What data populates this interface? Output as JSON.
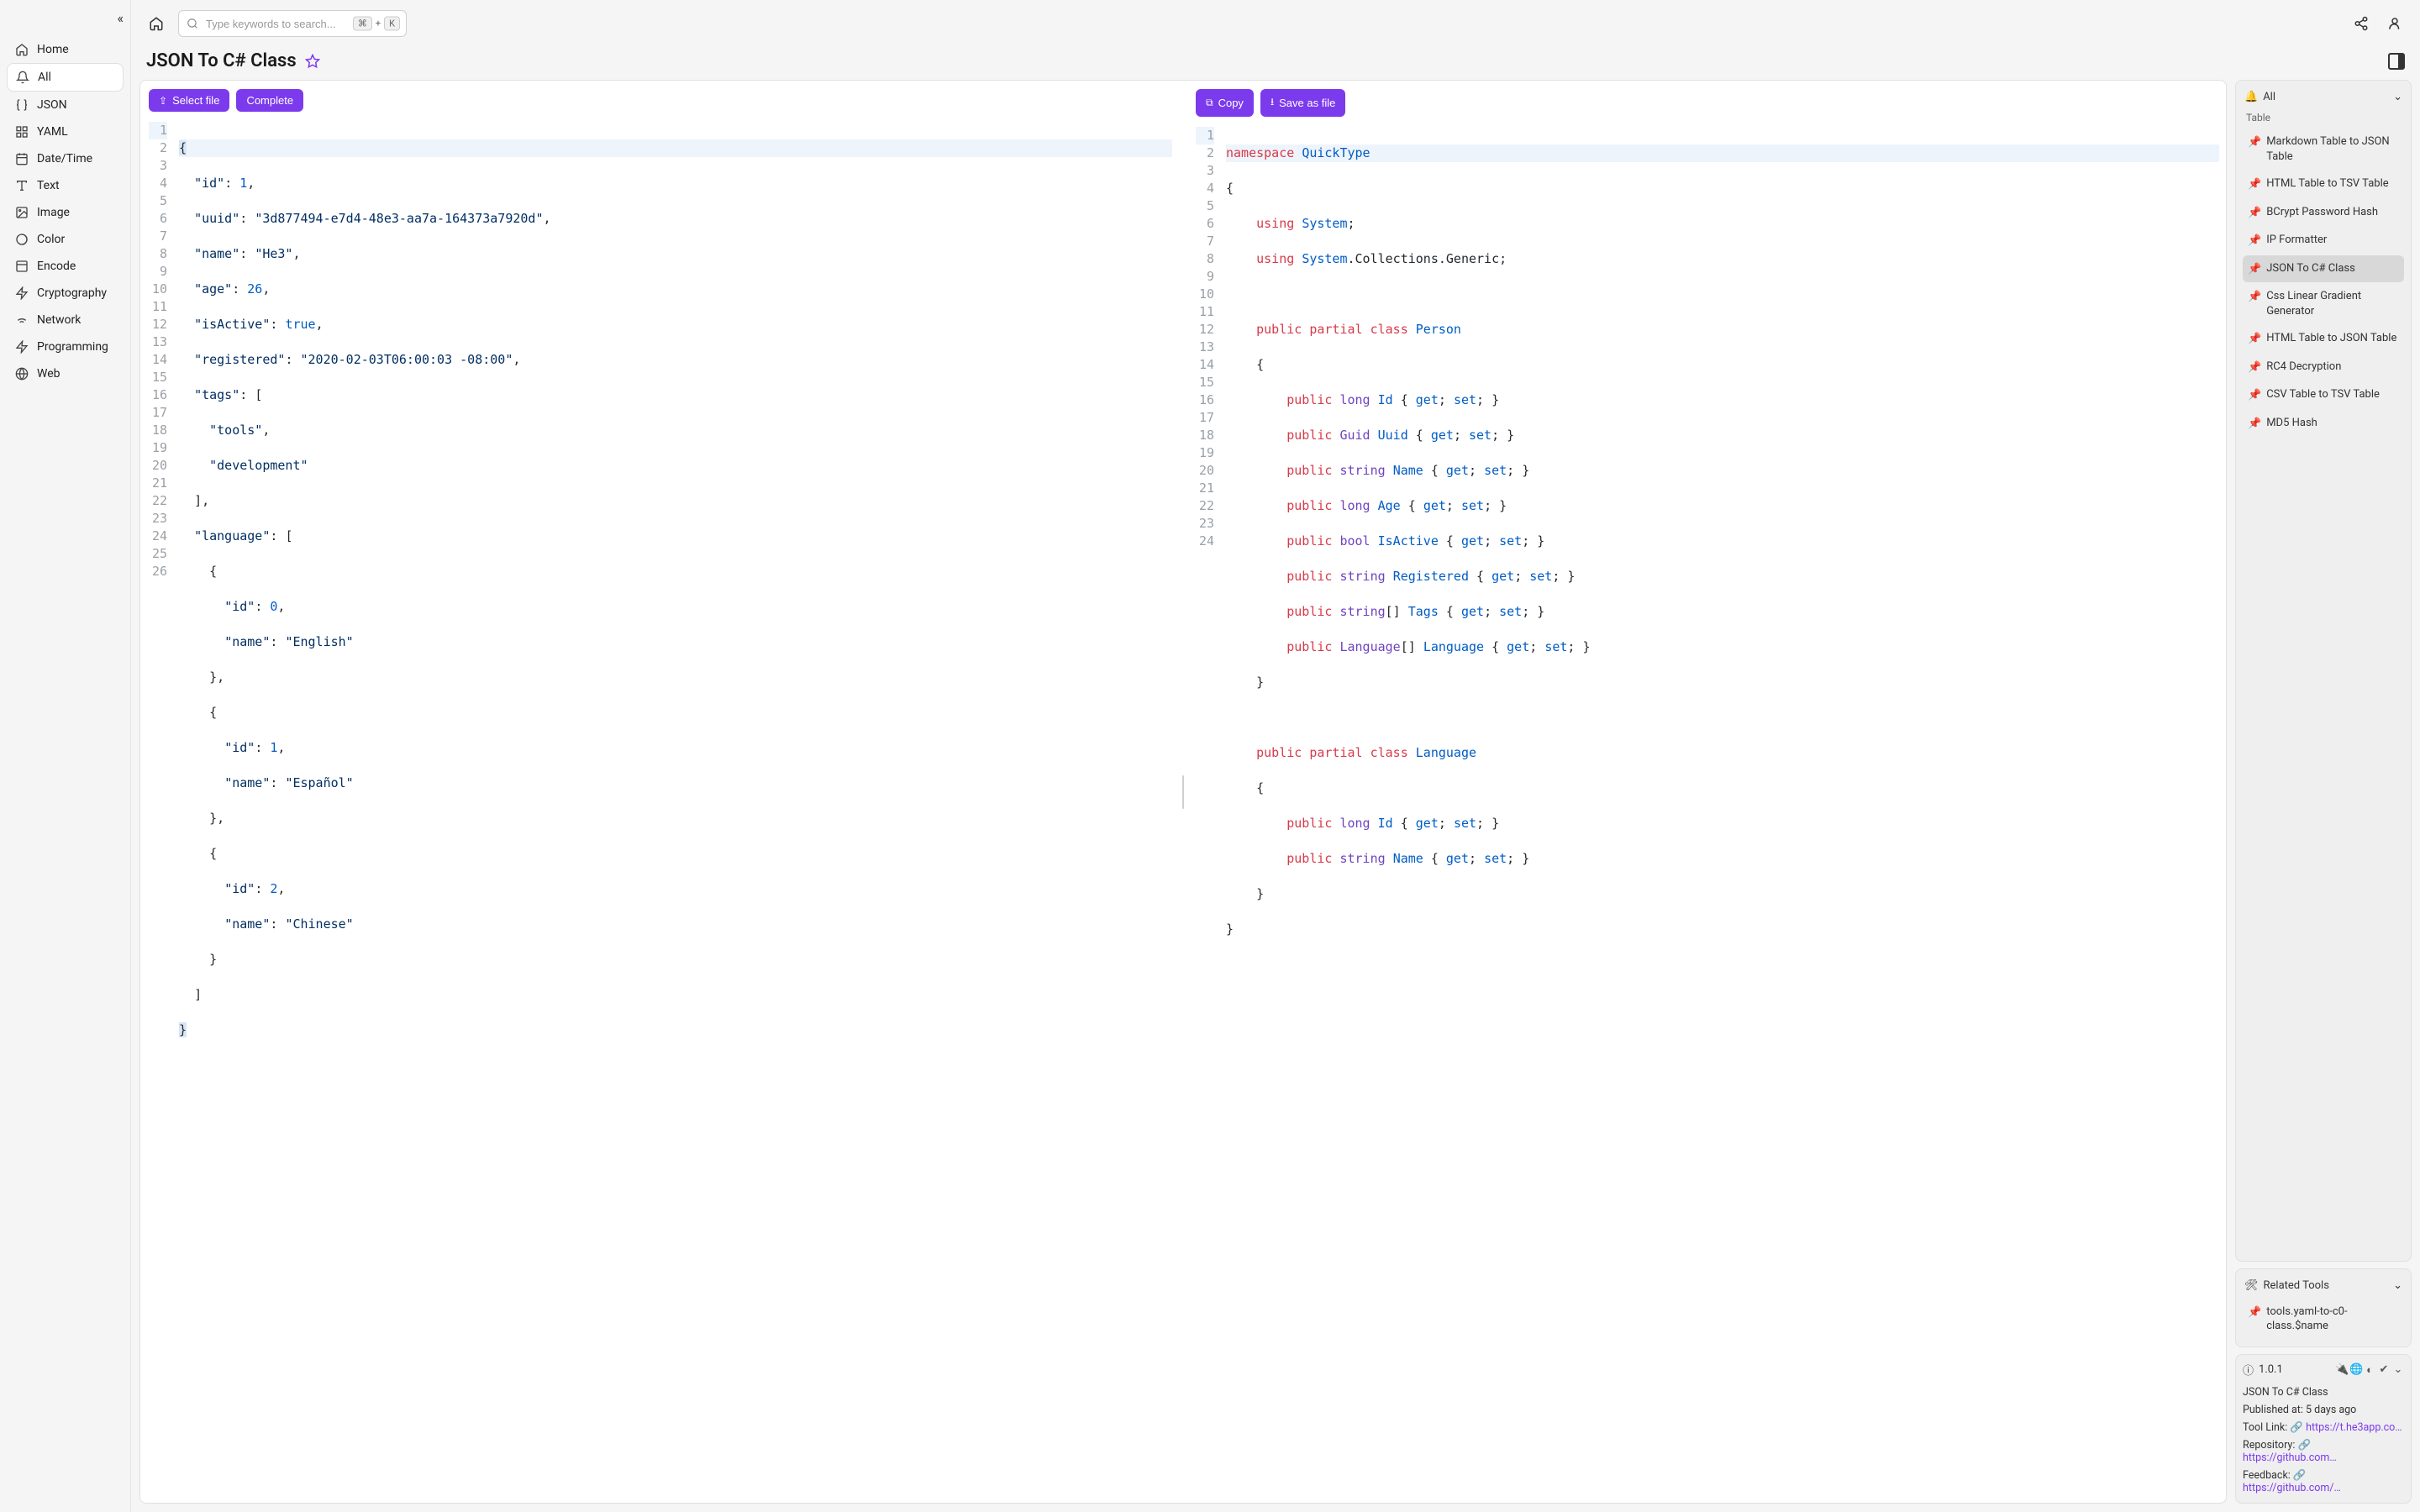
{
  "search": {
    "placeholder": "Type keywords to search...",
    "kbd1": "⌘",
    "kbd_plus": "+",
    "kbd2": "K"
  },
  "title": "JSON To C# Class",
  "sidebar": {
    "items": [
      {
        "label": "Home"
      },
      {
        "label": "All"
      },
      {
        "label": "JSON"
      },
      {
        "label": "YAML"
      },
      {
        "label": "Date/Time"
      },
      {
        "label": "Text"
      },
      {
        "label": "Image"
      },
      {
        "label": "Color"
      },
      {
        "label": "Encode"
      },
      {
        "label": "Cryptography"
      },
      {
        "label": "Network"
      },
      {
        "label": "Programming"
      },
      {
        "label": "Web"
      }
    ]
  },
  "left_toolbar": {
    "select_file": "Select file",
    "complete": "Complete"
  },
  "right_toolbar": {
    "copy": "Copy",
    "save": "Save as file"
  },
  "gutter_left": [
    "1",
    "2",
    "3",
    "4",
    "5",
    "6",
    "7",
    "8",
    "9",
    "10",
    "11",
    "12",
    "13",
    "14",
    "15",
    "16",
    "17",
    "18",
    "19",
    "20",
    "21",
    "22",
    "23",
    "24",
    "25",
    "26"
  ],
  "gutter_right": [
    "1",
    "2",
    "3",
    "4",
    "5",
    "6",
    "7",
    "8",
    "9",
    "10",
    "11",
    "12",
    "13",
    "14",
    "15",
    "16",
    "17",
    "18",
    "19",
    "20",
    "21",
    "22",
    "23",
    "24"
  ],
  "right_header": "All",
  "pinned_title": "Table",
  "pinned": [
    "Markdown Table to JSON Table",
    "HTML Table to TSV Table",
    "BCrypt Password Hash",
    "IP Formatter",
    "JSON To C# Class",
    "Css Linear Gradient Generator",
    "HTML Table to JSON Table",
    "RC4 Decryption",
    "CSV Table to TSV Table",
    "MD5 Hash"
  ],
  "related_header": "Related Tools",
  "related": [
    "tools.yaml-to-c0-class.$name"
  ],
  "version": "1.0.1",
  "meta": {
    "name": "JSON To C# Class",
    "published_label": "Published at:",
    "published_value": "5 days ago",
    "tool_link_label": "Tool Link:",
    "tool_link_value": "https://t.he3app.co…",
    "repo_label": "Repository:",
    "repo_value": "https://github.com…",
    "feedback_label": "Feedback:",
    "feedback_value": "https://github.com/…"
  }
}
